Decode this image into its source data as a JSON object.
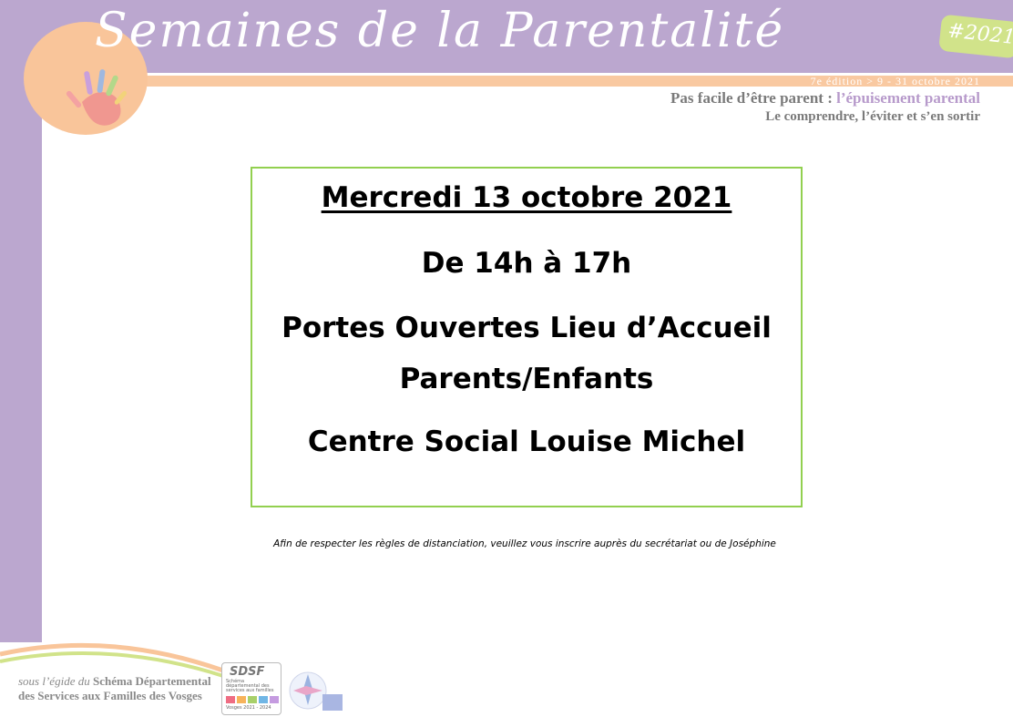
{
  "header": {
    "title": "Semaines de la Parentalité",
    "badge": "#2021",
    "edition": "7e édition  > 9 - 31 octobre 2021",
    "theme_prefix": "Pas facile d’être parent : ",
    "theme_highlight": "l’épuisement parental",
    "subtheme": "Le comprendre, l’éviter et s’en sortir"
  },
  "event": {
    "date": "Mercredi 13 octobre 2021",
    "time": "De 14h à 17h",
    "name_line1": "Portes Ouvertes Lieu d’Accueil",
    "name_line2": "Parents/Enfants",
    "place": "Centre Social Louise Michel"
  },
  "note": "Afin de respecter les règles de distanciation, veuillez vous inscrire auprès du secrétariat ou de Joséphine",
  "footer": {
    "egide_prefix": "sous l’égide du ",
    "egide_bold1": "Schéma Départemental",
    "egide_line2": "des Services aux Familles des Vosges",
    "sdsf_title": "SDSF",
    "sdsf_sub": "Schéma départemental des services aux familles",
    "sdsf_years": "Vosges 2021 - 2024"
  },
  "colors": {
    "purple": "#bba7cf",
    "orange": "#f9c59a",
    "green_border": "#92d050",
    "badge_green": "#d1e38a"
  }
}
